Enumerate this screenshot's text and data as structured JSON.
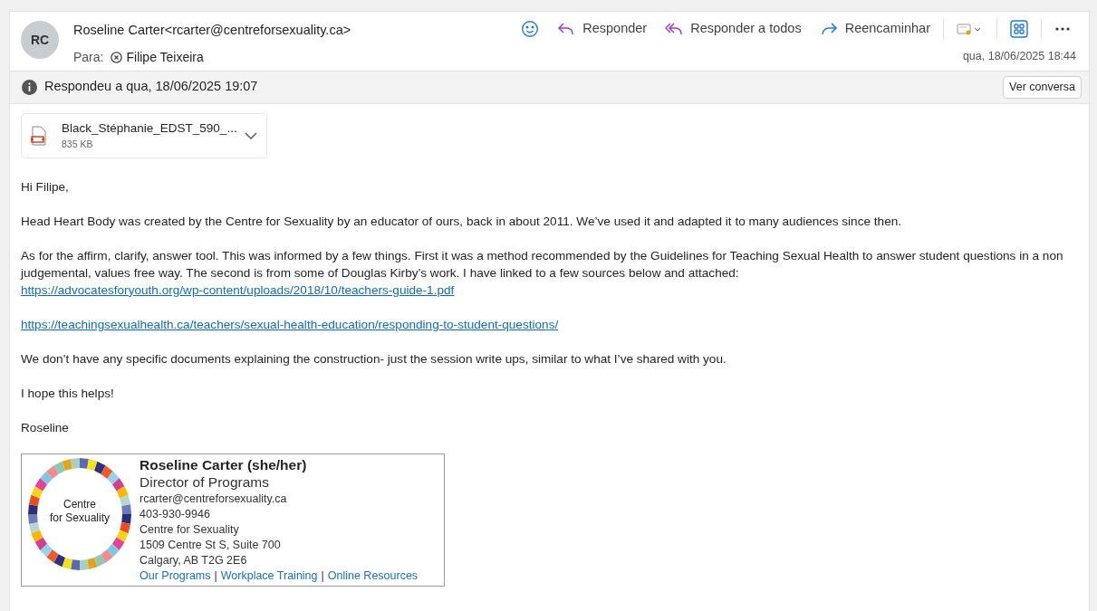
{
  "sender": {
    "initials": "RC",
    "address": "Roseline Carter<rcarter@centreforsexuality.ca>"
  },
  "to_label": "Para:",
  "recipients": [
    {
      "name": "Filipe Teixeira"
    }
  ],
  "toolbar": [
    {
      "kind": "emoji"
    },
    {
      "kind": "reply",
      "label": "Responder"
    },
    {
      "kind": "reply_all",
      "label": "Responder a todos"
    },
    {
      "kind": "forward",
      "label": "Reencaminhar"
    },
    {
      "kind": "tag"
    },
    {
      "kind": "apps"
    },
    {
      "kind": "more"
    }
  ],
  "date": "qua, 18/06/2025 18:44",
  "info_bar": {
    "text": "Respondeu a qua, 18/06/2025 19:07",
    "button": "Ver conversa"
  },
  "attachments": [
    {
      "name": "Black_Stéphanie_EDST_590_...",
      "size": "835 KB"
    }
  ],
  "body": [
    {
      "kind": "para",
      "parts": [
        {
          "kind": "text",
          "text": "Hi Filipe,"
        }
      ]
    },
    {
      "kind": "para",
      "parts": [
        {
          "kind": "text",
          "text": "Head Heart Body was created by the Centre for Sexuality by an educator of ours, back in about 2011. We’ve used it and adapted it to many audiences since then."
        }
      ]
    },
    {
      "kind": "para",
      "parts": [
        {
          "kind": "text",
          "text": "As for the affirm, clarify, answer tool. This was informed by a few things. First it was a method recommended by the Guidelines for Teaching Sexual Health to answer student questions in a non judgemental, values free way. The second is from some of Douglas Kirby’s work. I have linked to a few sources below and attached:"
        },
        {
          "kind": "link",
          "text": "https://advocatesforyouth.org/wp-content/uploads/2018/10/teachers-guide-1.pdf"
        }
      ]
    },
    {
      "kind": "para",
      "parts": [
        {
          "kind": "link",
          "text": "https://teachingsexualhealth.ca/teachers/sexual-health-education/responding-to-student-questions/"
        }
      ]
    },
    {
      "kind": "blank"
    },
    {
      "kind": "para",
      "parts": [
        {
          "kind": "text",
          "text": "We don’t have any specific documents explaining the construction- just the session write ups, similar to what I’ve shared with you."
        }
      ]
    },
    {
      "kind": "para",
      "parts": [
        {
          "kind": "text",
          "text": "I hope this helps!"
        }
      ]
    },
    {
      "kind": "para",
      "parts": [
        {
          "kind": "text",
          "text": "Roseline"
        }
      ]
    }
  ],
  "signature": {
    "logo_text": [
      "Centre",
      "for Sexuality"
    ],
    "name": "Roseline Carter (she/her)",
    "title": "Director of Programs",
    "lines": [
      "rcarter@centreforsexuality.ca",
      "403-930-9946",
      "Centre for Sexuality",
      "1509 Centre St S, Suite 700",
      "Calgary, AB T2G 2E6"
    ],
    "links": [
      "Our Programs",
      "Workplace Training",
      "Online Resources"
    ],
    "separator": "|"
  }
}
